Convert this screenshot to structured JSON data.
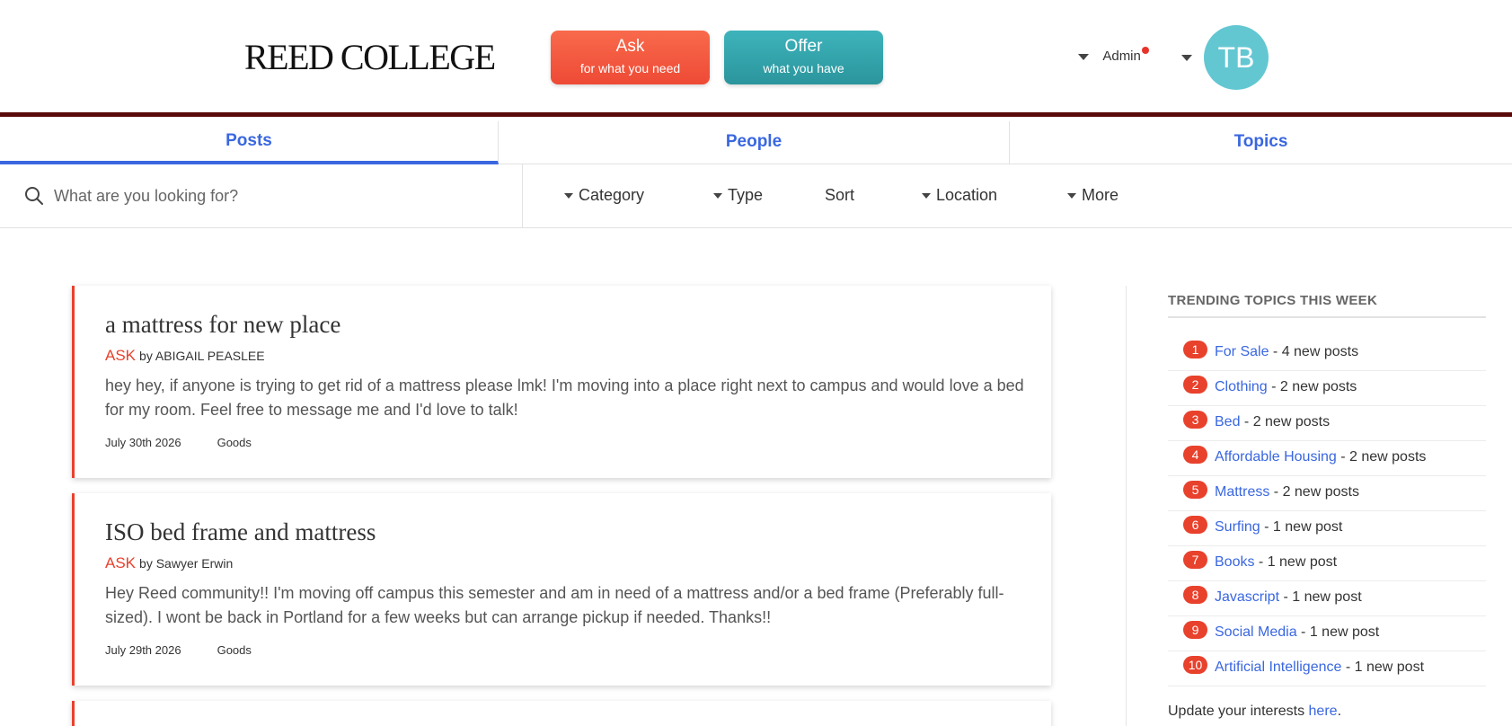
{
  "header": {
    "logo": "REED COLLEGE",
    "ask": {
      "title": "Ask",
      "subtitle": "for what you need"
    },
    "offer": {
      "title": "Offer",
      "subtitle": "what you have"
    },
    "admin_label": "Admin",
    "avatar_initials": "TB"
  },
  "tabs": [
    {
      "label": "Posts",
      "active": true
    },
    {
      "label": "People",
      "active": false
    },
    {
      "label": "Topics",
      "active": false
    }
  ],
  "search": {
    "placeholder": "What are you looking for?"
  },
  "filters": [
    "Category",
    "Type",
    "Sort",
    "Location",
    "More"
  ],
  "posts": [
    {
      "title": "a mattress for new place",
      "kind": "ASK",
      "by": "by ABIGAIL PEASLEE",
      "body": "hey hey, if anyone is trying to get rid of a mattress please lmk! I'm moving into a place right next to campus and would love a bed for my room. Feel free to message me and I'd love to talk!",
      "date": "July 30th 2026",
      "category": "Goods"
    },
    {
      "title": "ISO bed frame and mattress",
      "kind": "ASK",
      "by": "by Sawyer Erwin",
      "body": "Hey Reed community!! I'm moving off campus this semester and am in need of a mattress and/or a bed frame (Preferably full-sized). I wont be back in Portland for a few weeks but can arrange pickup if needed. Thanks!!",
      "date": "July 29th 2026",
      "category": "Goods"
    }
  ],
  "sidebar": {
    "title": "TRENDING TOPICS THIS WEEK",
    "topics": [
      {
        "rank": "1",
        "name": "For Sale",
        "count": " - 4 new posts"
      },
      {
        "rank": "2",
        "name": "Clothing",
        "count": " - 2 new posts"
      },
      {
        "rank": "3",
        "name": "Bed",
        "count": " - 2 new posts"
      },
      {
        "rank": "4",
        "name": "Affordable Housing",
        "count": " - 2 new posts"
      },
      {
        "rank": "5",
        "name": "Mattress",
        "count": " - 2 new posts"
      },
      {
        "rank": "6",
        "name": "Surfing",
        "count": " - 1 new post"
      },
      {
        "rank": "7",
        "name": "Books",
        "count": " - 1 new post"
      },
      {
        "rank": "8",
        "name": "Javascript",
        "count": " - 1 new post"
      },
      {
        "rank": "9",
        "name": "Social Media",
        "count": " - 1 new post"
      },
      {
        "rank": "10",
        "name": "Artificial Intelligence",
        "count": " - 1 new post"
      }
    ],
    "update_prefix": "Update your interests ",
    "update_link": "here",
    "update_suffix": "."
  },
  "colors": {
    "accent": "#3a67e0",
    "ask": "#ee4a35",
    "offer": "#2b959c",
    "brand_bar": "#5a0a0a"
  }
}
